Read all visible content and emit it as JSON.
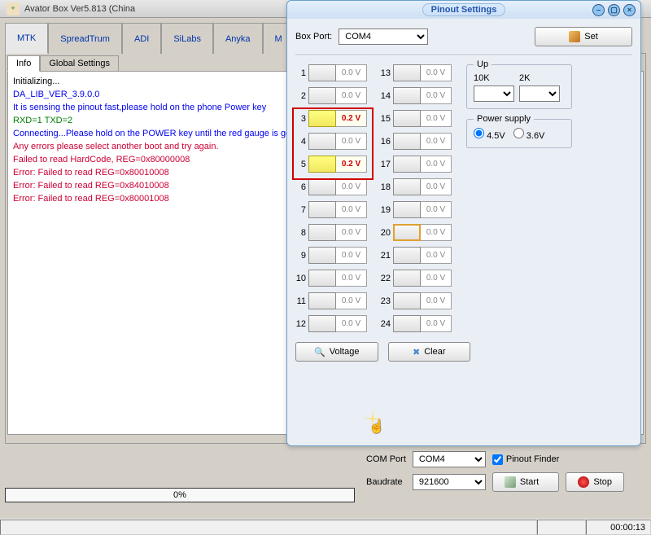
{
  "main_title": "Avator Box Ver5.813 (China",
  "tabs": [
    "MTK",
    "SpreadTrum",
    "ADI",
    "SiLabs",
    "Anyka",
    "M"
  ],
  "active_tab": 0,
  "inner_tabs": [
    "Info",
    "Global Settings"
  ],
  "log": [
    {
      "text": "Initializing...",
      "class": "c-black"
    },
    {
      "text": "DA_LIB_VER_3.9.0.0",
      "class": "c-blue"
    },
    {
      "text": "It is sensing the pinout fast,please hold on the phone Power key",
      "class": "c-blue"
    },
    {
      "text": "RXD=1 TXD=2",
      "class": "c-green"
    },
    {
      "text": "Connecting...Please hold on the POWER key until the red gauge is go",
      "class": "c-blue"
    },
    {
      "text": "Any errors please select another boot and try again.",
      "class": "c-red"
    },
    {
      "text": "Failed to read HardCode, REG=0x80000008",
      "class": "c-red"
    },
    {
      "text": "Error: Failed to read REG=0x80010008",
      "class": "c-red"
    },
    {
      "text": "Error: Failed to read REG=0x84010008",
      "class": "c-red"
    },
    {
      "text": "Error: Failed to read REG=0x80001008",
      "class": "c-red"
    }
  ],
  "progress_text": "0%",
  "com_port_label": "COM Port",
  "com_port_value": "COM4",
  "baudrate_label": "Baudrate",
  "baudrate_value": "921600",
  "pinout_finder_label": "Pinout Finder",
  "pinout_finder_checked": true,
  "start_label": "Start",
  "stop_label": "Stop",
  "elapsed": "00:00:13",
  "dialog": {
    "title": "Pinout Settings",
    "boxport_label": "Box Port:",
    "boxport_value": "COM4",
    "set_label": "Set",
    "pins_left": [
      {
        "n": 1,
        "v": "0.0 V"
      },
      {
        "n": 2,
        "v": "0.0 V"
      },
      {
        "n": 3,
        "v": "0.2 V",
        "hl": true
      },
      {
        "n": 4,
        "v": "0.0 V"
      },
      {
        "n": 5,
        "v": "0.2 V",
        "hl": true
      },
      {
        "n": 6,
        "v": "0.0 V"
      },
      {
        "n": 7,
        "v": "0.0 V"
      },
      {
        "n": 8,
        "v": "0.0 V"
      },
      {
        "n": 9,
        "v": "0.0 V"
      },
      {
        "n": 10,
        "v": "0.0 V"
      },
      {
        "n": 11,
        "v": "0.0 V"
      },
      {
        "n": 12,
        "v": "0.0 V"
      }
    ],
    "pins_right": [
      {
        "n": 13,
        "v": "0.0 V"
      },
      {
        "n": 14,
        "v": "0.0 V"
      },
      {
        "n": 15,
        "v": "0.0 V"
      },
      {
        "n": 16,
        "v": "0.0 V"
      },
      {
        "n": 17,
        "v": "0.0 V"
      },
      {
        "n": 18,
        "v": "0.0 V"
      },
      {
        "n": 19,
        "v": "0.0 V"
      },
      {
        "n": 20,
        "v": "0.0 V",
        "sel": true
      },
      {
        "n": 21,
        "v": "0.0 V"
      },
      {
        "n": 22,
        "v": "0.0 V"
      },
      {
        "n": 23,
        "v": "0.0 V"
      },
      {
        "n": 24,
        "v": "0.0 V"
      }
    ],
    "up_label": "Up",
    "up_10k": "10K",
    "up_2k": "2K",
    "power_label": "Power supply",
    "power_45": "4.5V",
    "power_36": "3.6V",
    "voltage_label": "Voltage",
    "clear_label": "Clear"
  }
}
